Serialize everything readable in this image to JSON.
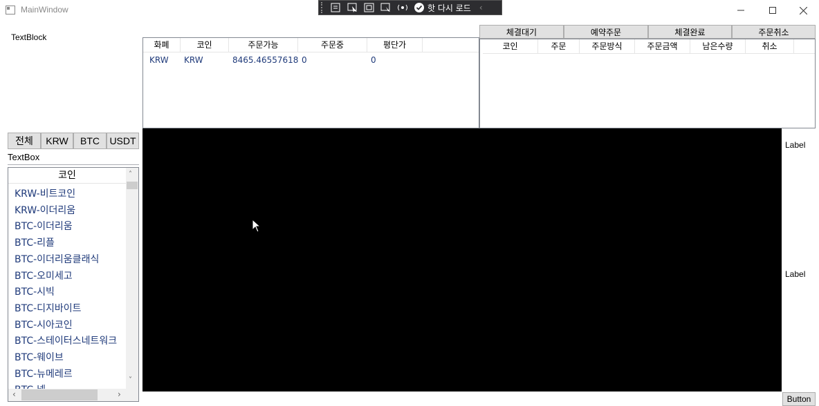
{
  "window": {
    "title": "MainWindow"
  },
  "debug_toolbar": {
    "hot_reload_label": "핫 다시 로드"
  },
  "left": {
    "textblock": "TextBlock",
    "filter_buttons": [
      "전체",
      "KRW",
      "BTC",
      "USDT"
    ],
    "textbox_label": "TextBox",
    "coin_list": {
      "header": "코인",
      "items": [
        "KRW-비트코인",
        "KRW-이더리움",
        "BTC-이더리움",
        "BTC-리플",
        "BTC-이더리움클래식",
        "BTC-오미세고",
        "BTC-시빅",
        "BTC-디지바이트",
        "BTC-시아코인",
        "BTC-스테이터스네트워크",
        "BTC-웨이브",
        "BTC-뉴메레르",
        "BTC-넴"
      ]
    }
  },
  "balance_grid": {
    "headers": [
      "화폐",
      "코인",
      "주문가능",
      "주문중",
      "평단가"
    ],
    "rows": [
      [
        "KRW",
        "KRW",
        "8465.46557618",
        "0",
        "0"
      ]
    ]
  },
  "order_tabs": [
    "체결대기",
    "예약주문",
    "체결완료",
    "주문취소"
  ],
  "order_grid": {
    "headers": [
      "코인",
      "주문",
      "주문방식",
      "주문금액",
      "남은수량",
      "취소"
    ]
  },
  "right": {
    "label_top": "Label",
    "label_bottom": "Label",
    "button": "Button"
  }
}
